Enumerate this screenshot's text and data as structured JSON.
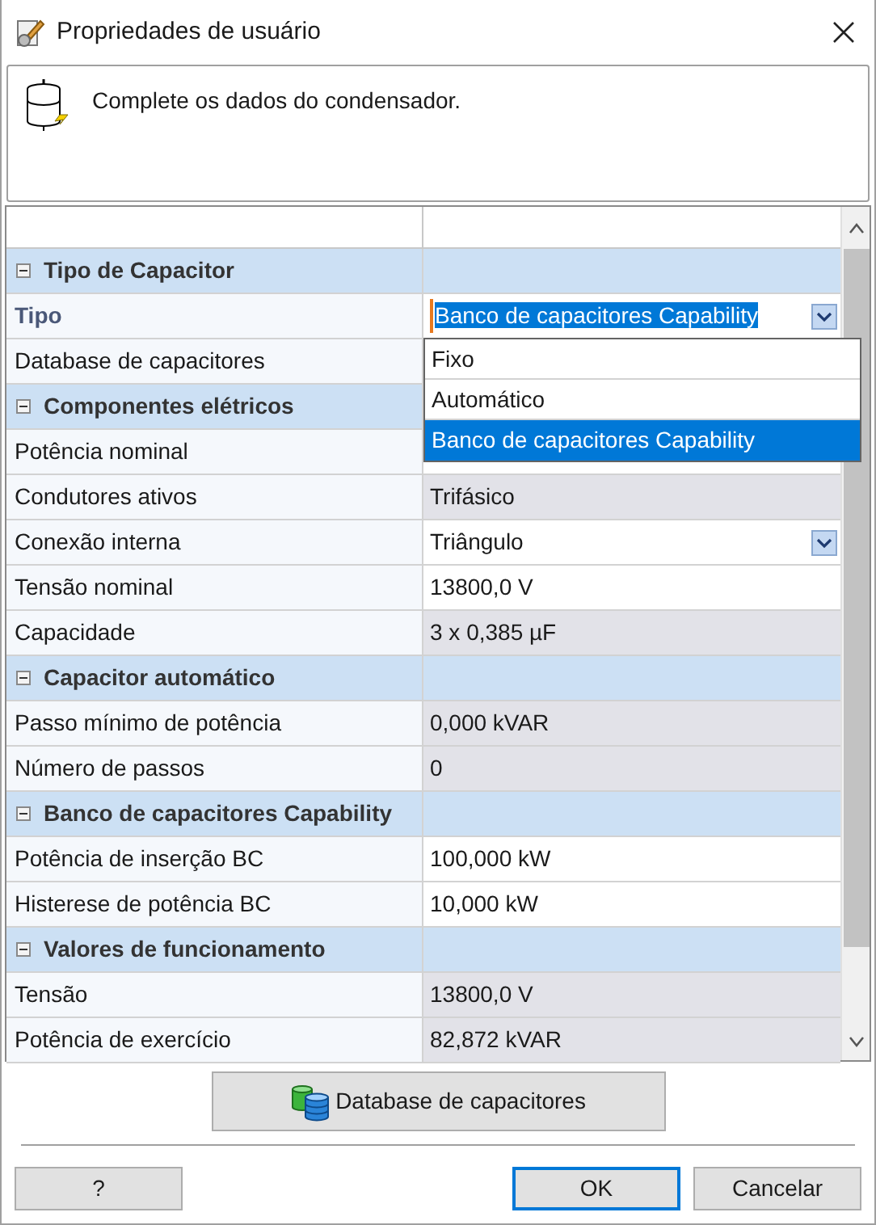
{
  "window": {
    "title": "Propriedades de usuário"
  },
  "message": "Complete os dados do condensador.",
  "grid": {
    "rows": [
      {
        "kind": "section",
        "label": "Tipo de Capacitor",
        "expanded": true
      },
      {
        "kind": "property",
        "label": "Tipo",
        "value": "Banco de capacitores Capability",
        "selected": true,
        "readonly": false,
        "dropdown": true,
        "open": true,
        "options": [
          {
            "label": "Fixo",
            "selected": false
          },
          {
            "label": "Automático",
            "selected": false
          },
          {
            "label": "Banco de capacitores Capability",
            "selected": true
          }
        ]
      },
      {
        "kind": "property",
        "label": "Database de capacitores",
        "selected": false
      },
      {
        "kind": "section",
        "label": "Componentes elétricos",
        "expanded": true
      },
      {
        "kind": "property",
        "label": "Potência nominal",
        "selected": false
      },
      {
        "kind": "property",
        "label": "Condutores ativos",
        "value": "Trifásico",
        "selected": false,
        "readonly": true,
        "dropdown": false
      },
      {
        "kind": "property",
        "label": "Conexão interna",
        "value": "Triângulo",
        "selected": false,
        "readonly": false,
        "dropdown": true
      },
      {
        "kind": "property",
        "label": "Tensão nominal",
        "value": "13800,0 V",
        "selected": false,
        "readonly": false,
        "dropdown": false
      },
      {
        "kind": "property",
        "label": "Capacidade",
        "value": "3 x 0,385 µF",
        "selected": false,
        "readonly": true,
        "dropdown": false
      },
      {
        "kind": "section",
        "label": "Capacitor automático",
        "expanded": true
      },
      {
        "kind": "property",
        "label": "Passo mínimo de potência",
        "value": "0,000 kVAR",
        "selected": false,
        "readonly": true,
        "dropdown": false
      },
      {
        "kind": "property",
        "label": "Número de passos",
        "value": "0",
        "selected": false,
        "readonly": true,
        "dropdown": false
      },
      {
        "kind": "section",
        "label": "Banco de capacitores Capability",
        "expanded": true
      },
      {
        "kind": "property",
        "label": "Potência de inserção BC",
        "value": "100,000 kW",
        "selected": false,
        "readonly": false,
        "dropdown": false
      },
      {
        "kind": "property",
        "label": "Histerese de potência BC",
        "value": "10,000 kW",
        "selected": false,
        "readonly": false,
        "dropdown": false
      },
      {
        "kind": "section",
        "label": "Valores de funcionamento",
        "expanded": true
      },
      {
        "kind": "property",
        "label": "Tensão",
        "value": "13800,0 V",
        "selected": false,
        "readonly": true,
        "dropdown": false
      },
      {
        "kind": "property",
        "label": "Potência de exercício",
        "value": "82,872 kVAR",
        "selected": false,
        "readonly": true,
        "dropdown": false
      }
    ]
  },
  "database_button": "Database de capacitores",
  "buttons": [
    {
      "label": "?",
      "default": false
    },
    {
      "label": "OK",
      "default": true
    },
    {
      "label": "Cancelar",
      "default": false
    }
  ]
}
